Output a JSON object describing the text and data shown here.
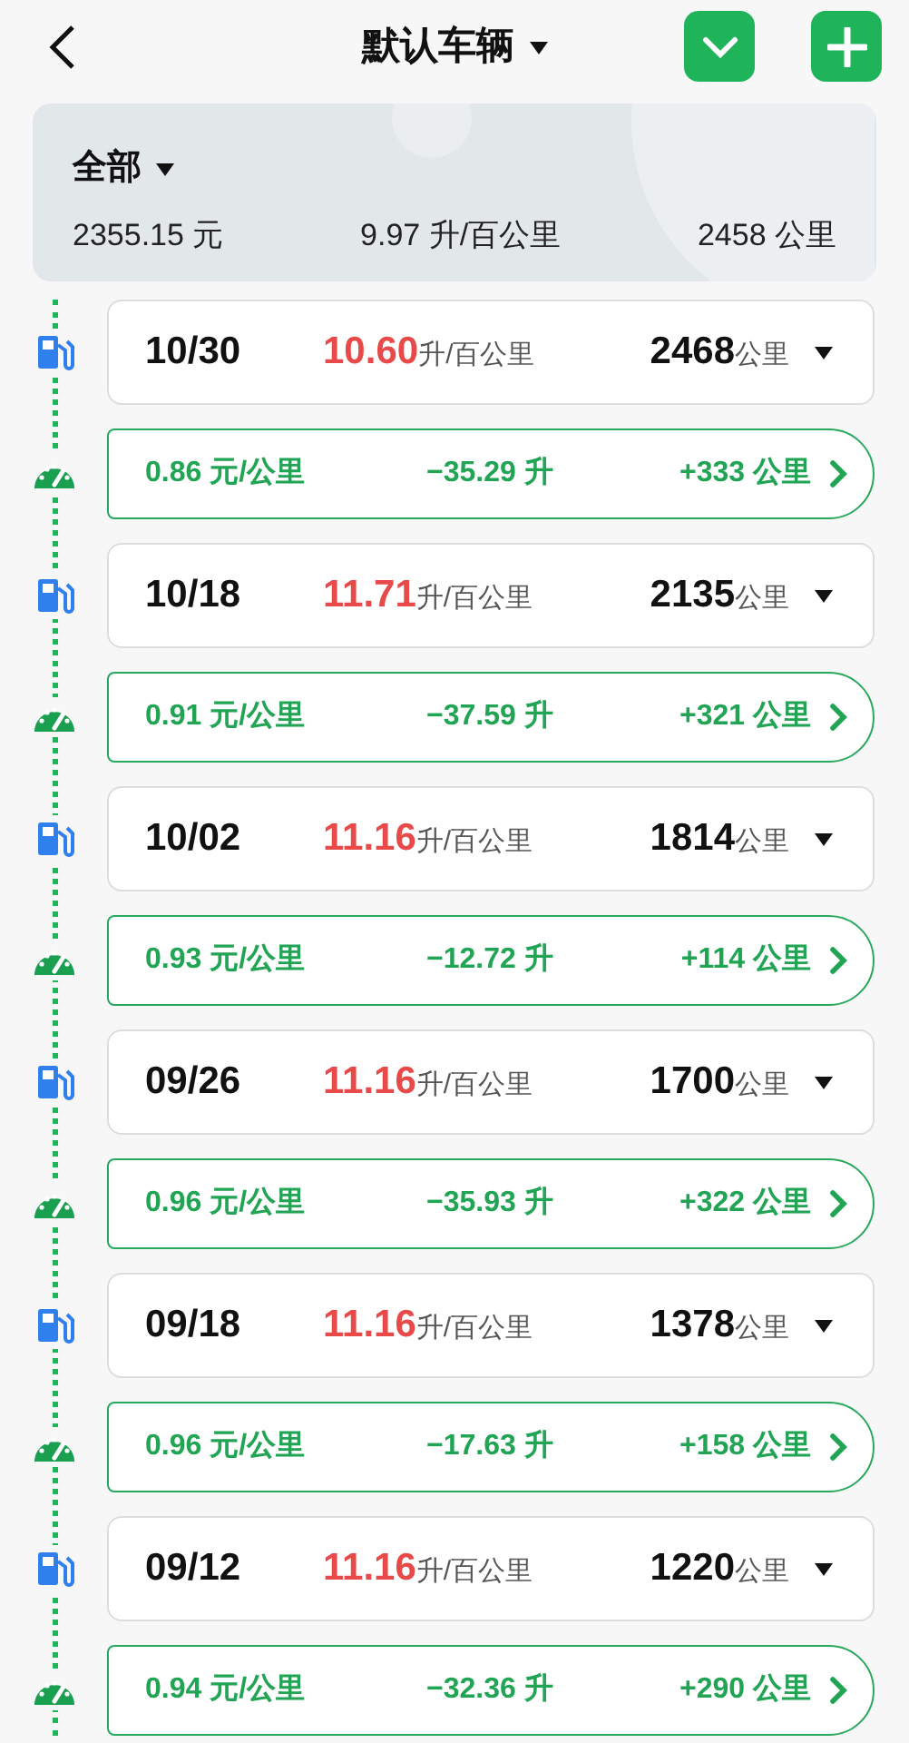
{
  "header": {
    "title": "默认车辆"
  },
  "summary": {
    "filter": "全部",
    "total_cost": "2355.15 元",
    "avg_consumption": "9.97 升/百公里",
    "total_distance": "2458 公里"
  },
  "entries": [
    {
      "date": "10/30",
      "consumption": "10.60",
      "consumption_unit": "升/百公里",
      "odometer": "2468",
      "odometer_unit": "公里",
      "cost_per_km": "0.86 元/公里",
      "fuel_change": "−35.29 升",
      "distance_change": "+333 公里"
    },
    {
      "date": "10/18",
      "consumption": "11.71",
      "consumption_unit": "升/百公里",
      "odometer": "2135",
      "odometer_unit": "公里",
      "cost_per_km": "0.91 元/公里",
      "fuel_change": "−37.59 升",
      "distance_change": "+321 公里"
    },
    {
      "date": "10/02",
      "consumption": "11.16",
      "consumption_unit": "升/百公里",
      "odometer": "1814",
      "odometer_unit": "公里",
      "cost_per_km": "0.93 元/公里",
      "fuel_change": "−12.72 升",
      "distance_change": "+114 公里"
    },
    {
      "date": "09/26",
      "consumption": "11.16",
      "consumption_unit": "升/百公里",
      "odometer": "1700",
      "odometer_unit": "公里",
      "cost_per_km": "0.96 元/公里",
      "fuel_change": "−35.93 升",
      "distance_change": "+322 公里"
    },
    {
      "date": "09/18",
      "consumption": "11.16",
      "consumption_unit": "升/百公里",
      "odometer": "1378",
      "odometer_unit": "公里",
      "cost_per_km": "0.96 元/公里",
      "fuel_change": "−17.63 升",
      "distance_change": "+158 公里"
    },
    {
      "date": "09/12",
      "consumption": "11.16",
      "consumption_unit": "升/百公里",
      "odometer": "1220",
      "odometer_unit": "公里",
      "cost_per_km": "0.94 元/公里",
      "fuel_change": "−32.36 升",
      "distance_change": "+290 公里"
    }
  ]
}
